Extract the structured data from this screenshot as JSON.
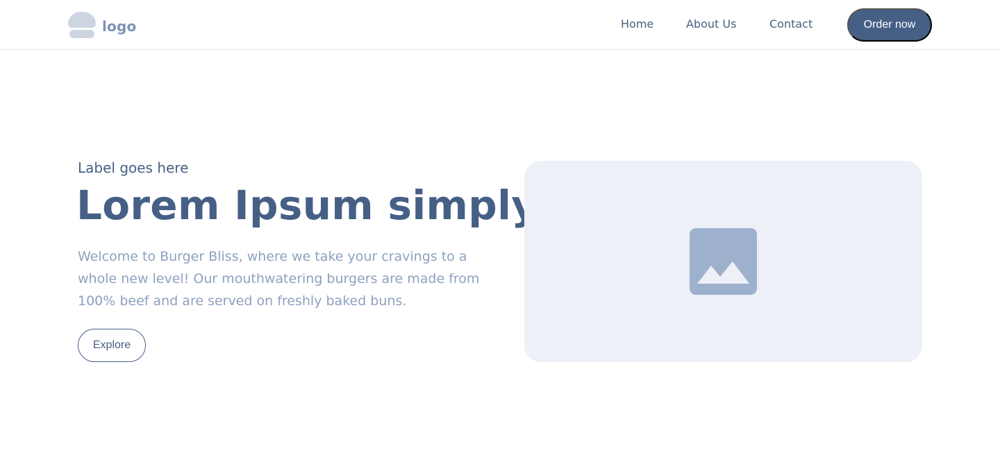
{
  "header": {
    "logo_text": "logo",
    "nav": {
      "home": "Home",
      "about": "About Us",
      "contact": "Contact"
    },
    "cta_label": "Order now"
  },
  "hero": {
    "label": "Label goes here",
    "title": "Lorem Ipsum simply",
    "description": "Welcome to Burger Bliss, where we take your cravings to a whole new level! Our mouthwatering burgers are made from 100% beef and are served on freshly baked buns.",
    "button_label": "Explore",
    "image_icon": "image-placeholder-icon"
  },
  "colors": {
    "primary": "#465f85",
    "muted_text": "#8ea1bf",
    "logo_mark": "#cdd5e2",
    "image_bg": "#edf0f6",
    "image_icon": "#9db0cc"
  }
}
